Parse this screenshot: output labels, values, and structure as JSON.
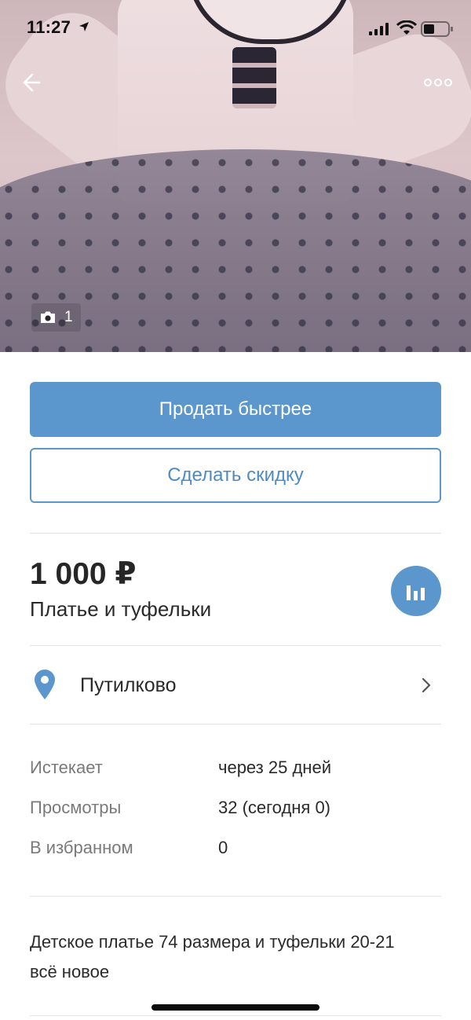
{
  "status_bar": {
    "time": "11:27"
  },
  "photo": {
    "count": "1"
  },
  "actions": {
    "sell_faster": "Продать быстрее",
    "make_discount": "Сделать скидку"
  },
  "listing": {
    "price": "1 000 ₽",
    "title": "Платье и туфельки",
    "location": "Путилково"
  },
  "info": {
    "expires_label": "Истекает",
    "expires_value": "через 25 дней",
    "views_label": "Просмотры",
    "views_value": "32 (сегодня 0)",
    "favorites_label": "В избранном",
    "favorites_value": "0"
  },
  "description": {
    "line1": "Детское платье 74 размера и туфельки 20-21",
    "line2": "всё новое"
  },
  "colors": {
    "accent": "#5b97cc",
    "text": "#2a2a2a",
    "muted": "#7a7a7a",
    "divider": "#e4e4e4"
  }
}
